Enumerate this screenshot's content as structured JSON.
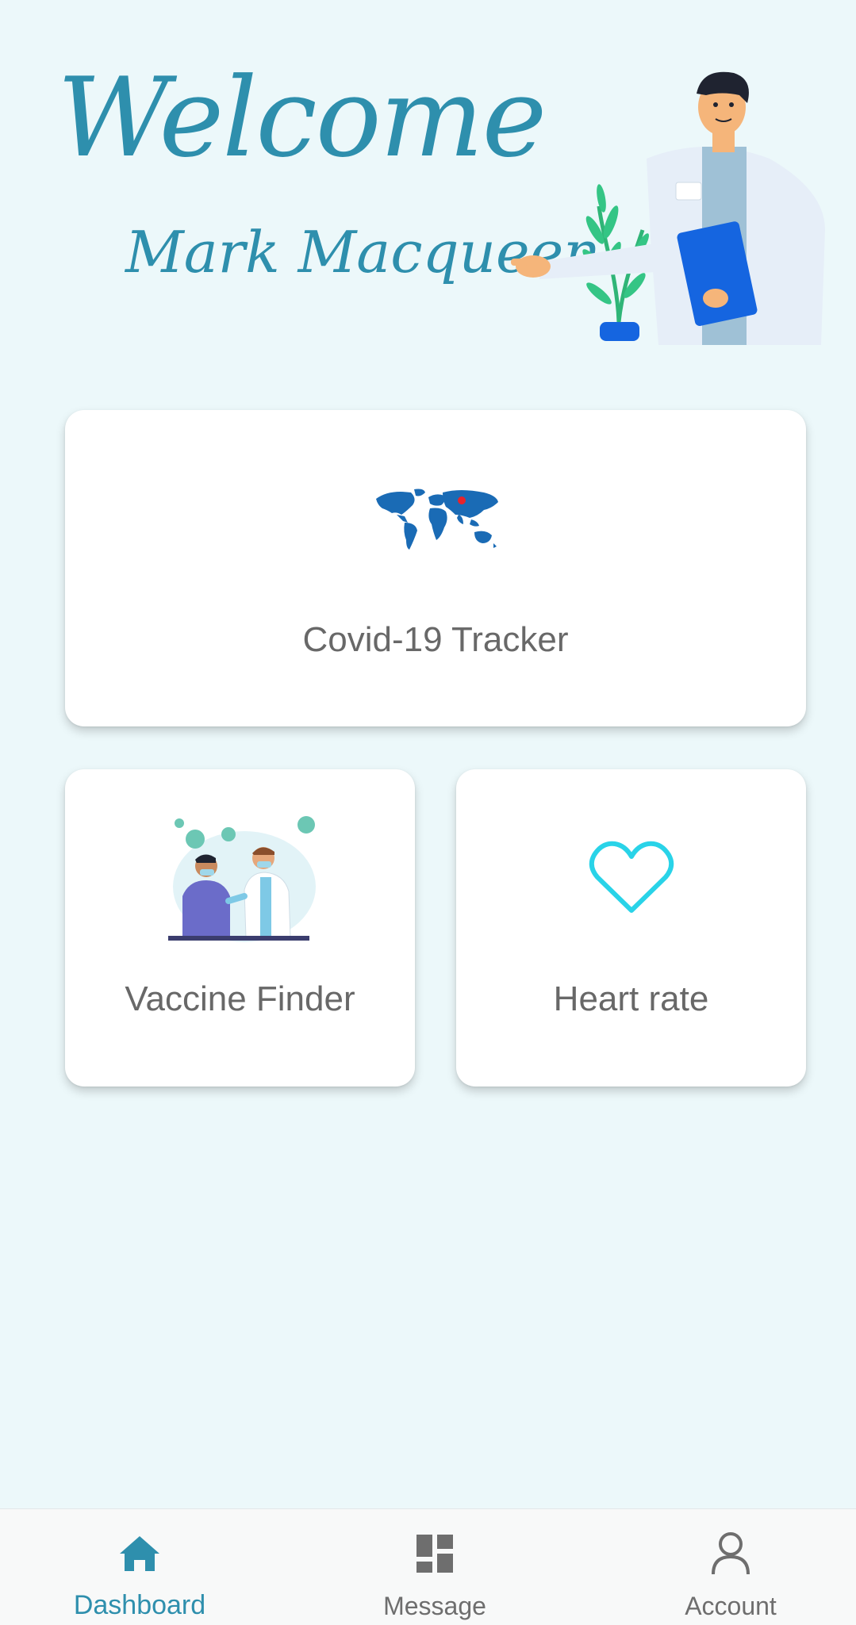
{
  "header": {
    "greeting": "Welcome",
    "user_name": "Mark Macqueen"
  },
  "cards": {
    "tracker": {
      "label": "Covid-19 Tracker",
      "icon": "world-map-icon"
    },
    "vaccine": {
      "label": "Vaccine Finder",
      "icon": "vaccination-illustration"
    },
    "heart": {
      "label": "Heart rate",
      "icon": "heart-outline-icon"
    }
  },
  "bottom_nav": {
    "items": [
      {
        "label": "Dashboard",
        "icon": "home-icon",
        "active": true
      },
      {
        "label": "Message",
        "icon": "grid-icon",
        "active": false
      },
      {
        "label": "Account",
        "icon": "person-icon",
        "active": false
      }
    ]
  },
  "colors": {
    "background": "#ecf8fa",
    "accent": "#2e8fad",
    "heart": "#29d3e8",
    "map": "#1a6bb5",
    "nav_inactive": "#6e6e6e"
  }
}
